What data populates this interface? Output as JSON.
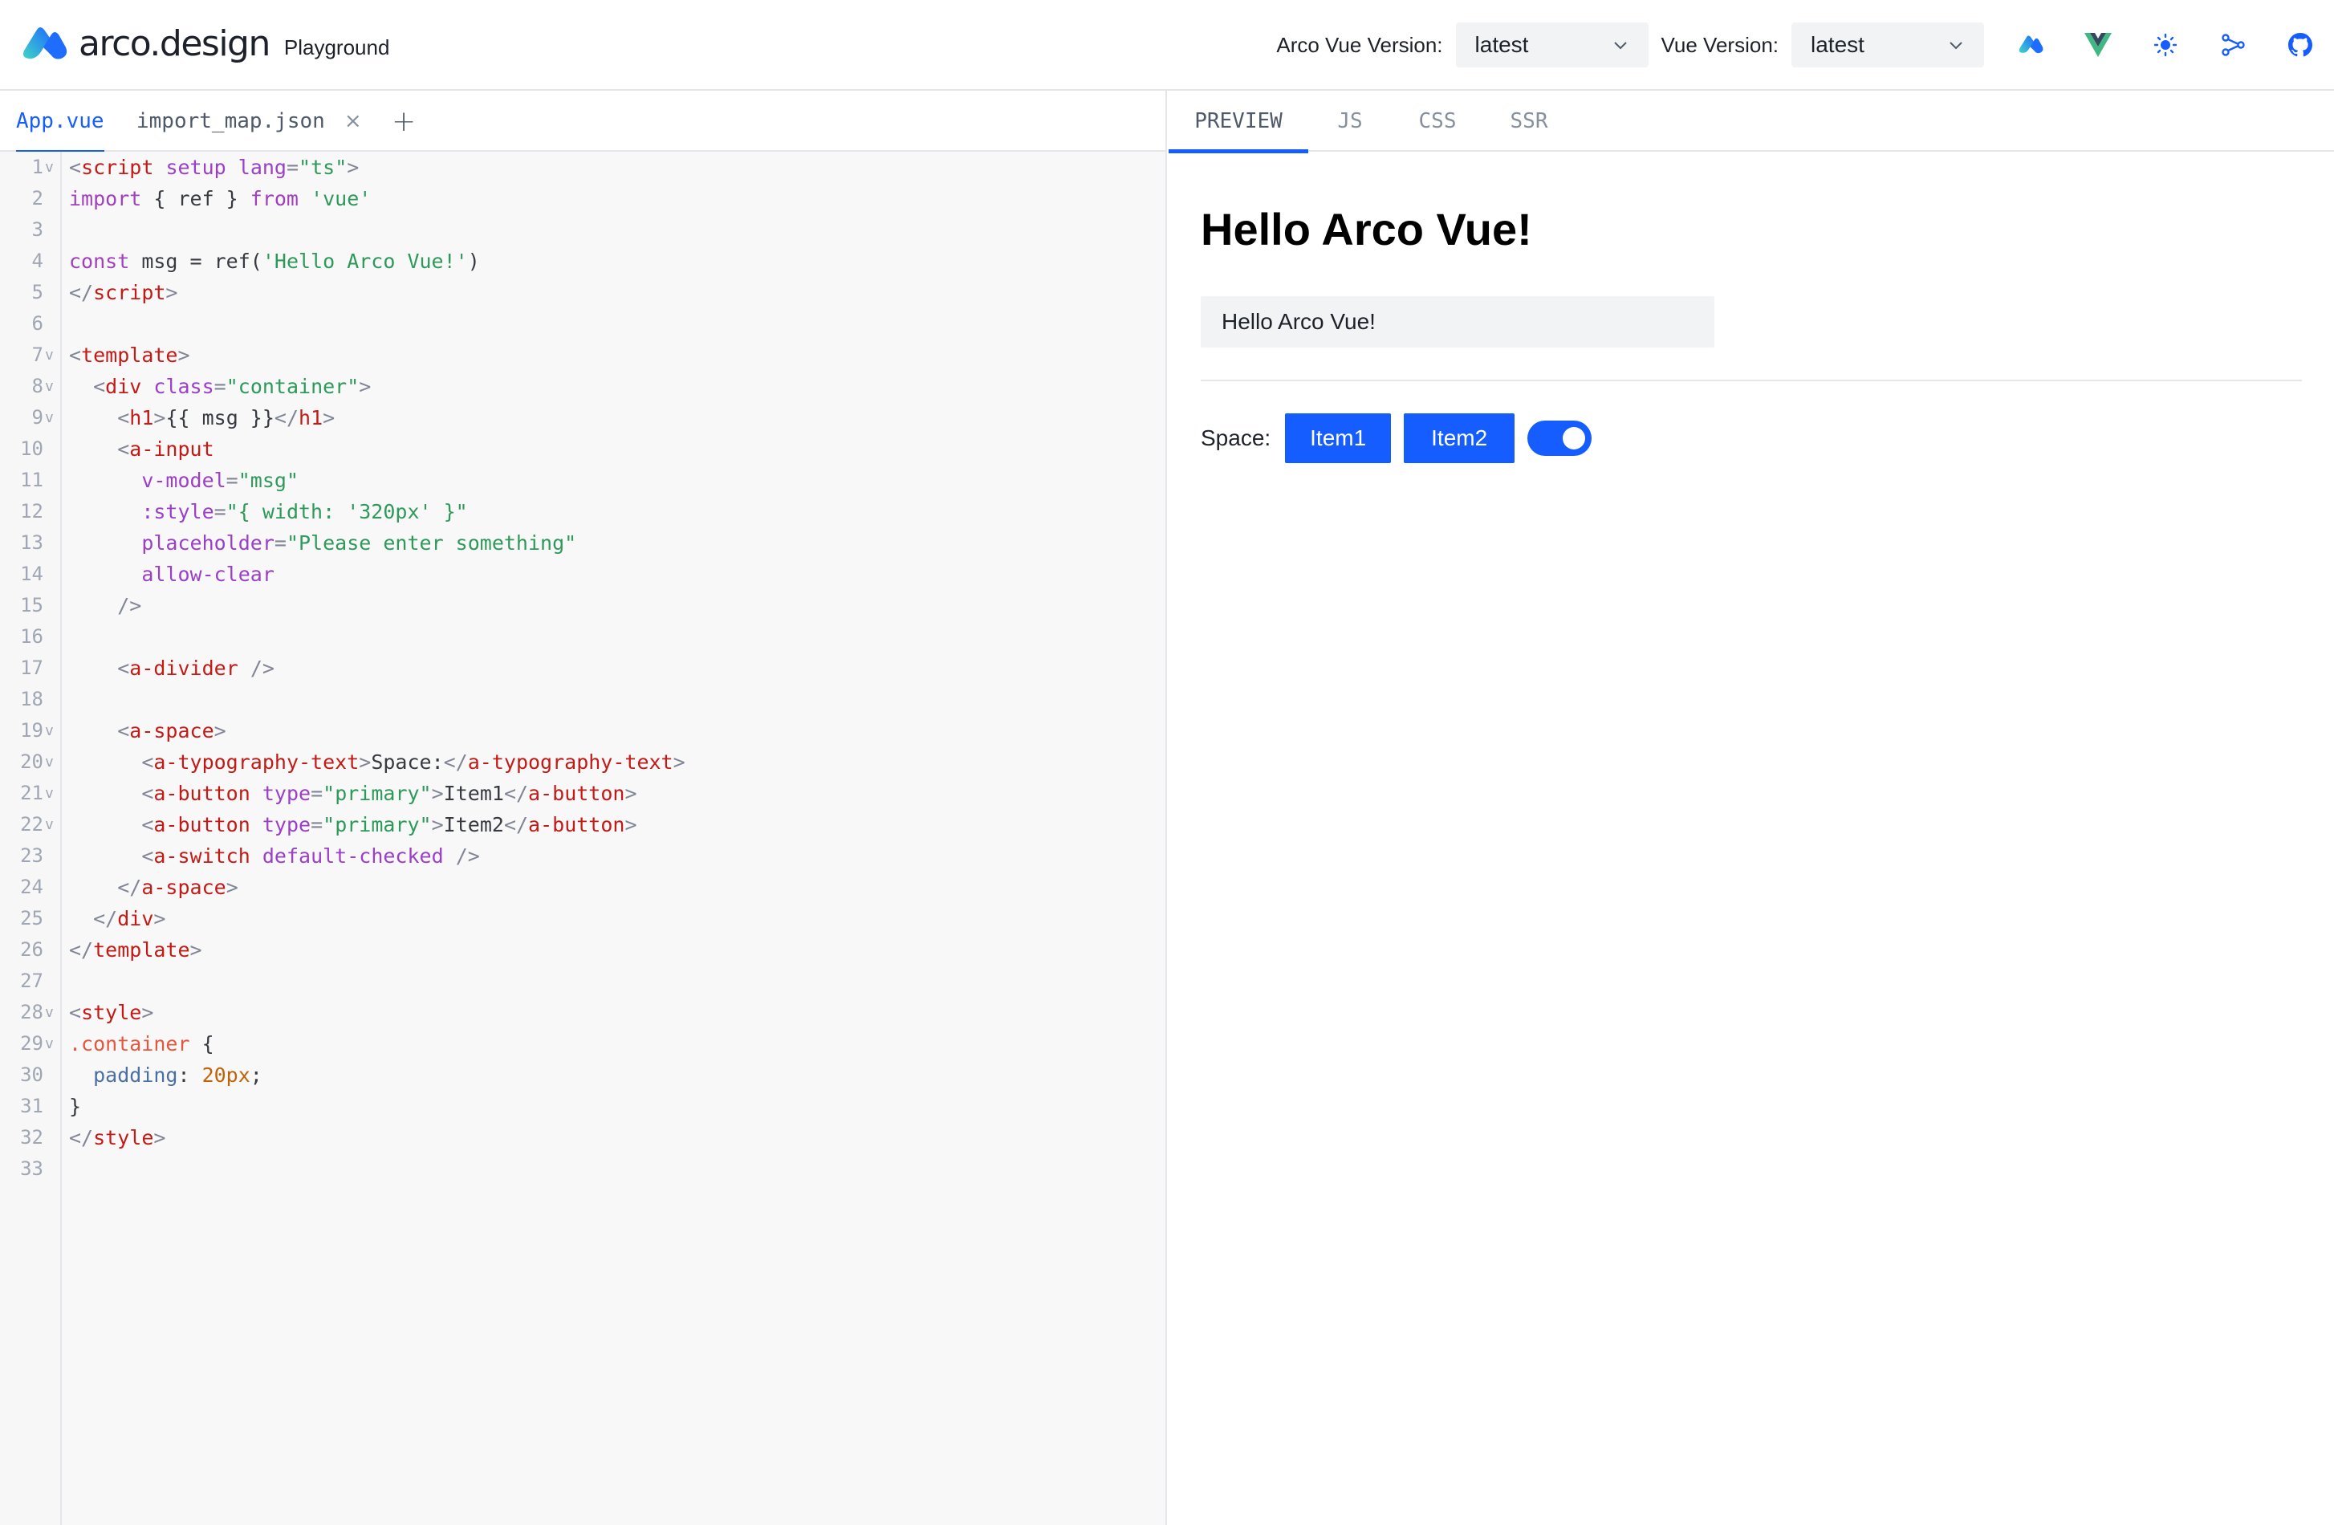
{
  "header": {
    "brand": "arco.design",
    "subtitle": "Playground",
    "arco_version_label": "Arco Vue Version:",
    "arco_version_value": "latest",
    "vue_version_label": "Vue Version:",
    "vue_version_value": "latest",
    "icons": [
      "arco-logo-icon",
      "vue-logo-icon",
      "theme-sun-icon",
      "share-icon",
      "github-icon"
    ]
  },
  "file_tabs": {
    "items": [
      {
        "label": "App.vue",
        "active": true,
        "closable": false
      },
      {
        "label": "import_map.json",
        "active": false,
        "closable": true
      }
    ],
    "close_glyph": "×",
    "add_glyph": "+"
  },
  "editor": {
    "lines": [
      {
        "n": "1",
        "fold": "v",
        "tokens": [
          [
            "punc",
            "<"
          ],
          [
            "tag",
            "script"
          ],
          [
            "plain",
            " "
          ],
          [
            "attr",
            "setup"
          ],
          [
            "plain",
            " "
          ],
          [
            "attr",
            "lang"
          ],
          [
            "punc",
            "="
          ],
          [
            "str",
            "\"ts\""
          ],
          [
            "punc",
            ">"
          ]
        ]
      },
      {
        "n": "2",
        "fold": "",
        "tokens": [
          [
            "kw",
            "import"
          ],
          [
            "plain",
            " { ref } "
          ],
          [
            "kw",
            "from"
          ],
          [
            "plain",
            " "
          ],
          [
            "str",
            "'vue'"
          ]
        ]
      },
      {
        "n": "3",
        "fold": "",
        "tokens": []
      },
      {
        "n": "4",
        "fold": "",
        "tokens": [
          [
            "kw",
            "const"
          ],
          [
            "plain",
            " msg = ref("
          ],
          [
            "str",
            "'Hello Arco Vue!'"
          ],
          [
            "plain",
            ")"
          ]
        ]
      },
      {
        "n": "5",
        "fold": "",
        "tokens": [
          [
            "punc",
            "</"
          ],
          [
            "tag",
            "script"
          ],
          [
            "punc",
            ">"
          ]
        ]
      },
      {
        "n": "6",
        "fold": "",
        "tokens": []
      },
      {
        "n": "7",
        "fold": "v",
        "tokens": [
          [
            "punc",
            "<"
          ],
          [
            "tag",
            "template"
          ],
          [
            "punc",
            ">"
          ]
        ]
      },
      {
        "n": "8",
        "fold": "v",
        "tokens": [
          [
            "plain",
            "  "
          ],
          [
            "punc",
            "<"
          ],
          [
            "tag",
            "div"
          ],
          [
            "plain",
            " "
          ],
          [
            "attr",
            "class"
          ],
          [
            "punc",
            "="
          ],
          [
            "str",
            "\"container\""
          ],
          [
            "punc",
            ">"
          ]
        ]
      },
      {
        "n": "9",
        "fold": "v",
        "tokens": [
          [
            "plain",
            "    "
          ],
          [
            "punc",
            "<"
          ],
          [
            "tag",
            "h1"
          ],
          [
            "punc",
            ">"
          ],
          [
            "plain",
            "{{ msg }}"
          ],
          [
            "punc",
            "</"
          ],
          [
            "tag",
            "h1"
          ],
          [
            "punc",
            ">"
          ]
        ]
      },
      {
        "n": "10",
        "fold": "",
        "tokens": [
          [
            "plain",
            "    "
          ],
          [
            "punc",
            "<"
          ],
          [
            "tag",
            "a-input"
          ]
        ]
      },
      {
        "n": "11",
        "fold": "",
        "tokens": [
          [
            "plain",
            "      "
          ],
          [
            "attr",
            "v-model"
          ],
          [
            "punc",
            "="
          ],
          [
            "str",
            "\"msg\""
          ]
        ]
      },
      {
        "n": "12",
        "fold": "",
        "tokens": [
          [
            "plain",
            "      "
          ],
          [
            "attr",
            ":style"
          ],
          [
            "punc",
            "="
          ],
          [
            "str",
            "\"{ width: '320px' }\""
          ]
        ]
      },
      {
        "n": "13",
        "fold": "",
        "tokens": [
          [
            "plain",
            "      "
          ],
          [
            "attr",
            "placeholder"
          ],
          [
            "punc",
            "="
          ],
          [
            "str",
            "\"Please enter something\""
          ]
        ]
      },
      {
        "n": "14",
        "fold": "",
        "tokens": [
          [
            "plain",
            "      "
          ],
          [
            "attr",
            "allow-clear"
          ]
        ]
      },
      {
        "n": "15",
        "fold": "",
        "tokens": [
          [
            "plain",
            "    "
          ],
          [
            "punc",
            "/>"
          ]
        ]
      },
      {
        "n": "16",
        "fold": "",
        "tokens": []
      },
      {
        "n": "17",
        "fold": "",
        "tokens": [
          [
            "plain",
            "    "
          ],
          [
            "punc",
            "<"
          ],
          [
            "tag",
            "a-divider"
          ],
          [
            "plain",
            " "
          ],
          [
            "punc",
            "/>"
          ]
        ]
      },
      {
        "n": "18",
        "fold": "",
        "tokens": []
      },
      {
        "n": "19",
        "fold": "v",
        "tokens": [
          [
            "plain",
            "    "
          ],
          [
            "punc",
            "<"
          ],
          [
            "tag",
            "a-space"
          ],
          [
            "punc",
            ">"
          ]
        ]
      },
      {
        "n": "20",
        "fold": "v",
        "tokens": [
          [
            "plain",
            "      "
          ],
          [
            "punc",
            "<"
          ],
          [
            "tag",
            "a-typography-text"
          ],
          [
            "punc",
            ">"
          ],
          [
            "plain",
            "Space:"
          ],
          [
            "punc",
            "</"
          ],
          [
            "tag",
            "a-typography-text"
          ],
          [
            "punc",
            ">"
          ]
        ]
      },
      {
        "n": "21",
        "fold": "v",
        "tokens": [
          [
            "plain",
            "      "
          ],
          [
            "punc",
            "<"
          ],
          [
            "tag",
            "a-button"
          ],
          [
            "plain",
            " "
          ],
          [
            "attr",
            "type"
          ],
          [
            "punc",
            "="
          ],
          [
            "str",
            "\"primary\""
          ],
          [
            "punc",
            ">"
          ],
          [
            "plain",
            "Item1"
          ],
          [
            "punc",
            "</"
          ],
          [
            "tag",
            "a-button"
          ],
          [
            "punc",
            ">"
          ]
        ]
      },
      {
        "n": "22",
        "fold": "v",
        "tokens": [
          [
            "plain",
            "      "
          ],
          [
            "punc",
            "<"
          ],
          [
            "tag",
            "a-button"
          ],
          [
            "plain",
            " "
          ],
          [
            "attr",
            "type"
          ],
          [
            "punc",
            "="
          ],
          [
            "str",
            "\"primary\""
          ],
          [
            "punc",
            ">"
          ],
          [
            "plain",
            "Item2"
          ],
          [
            "punc",
            "</"
          ],
          [
            "tag",
            "a-button"
          ],
          [
            "punc",
            ">"
          ]
        ]
      },
      {
        "n": "23",
        "fold": "",
        "tokens": [
          [
            "plain",
            "      "
          ],
          [
            "punc",
            "<"
          ],
          [
            "tag",
            "a-switch"
          ],
          [
            "plain",
            " "
          ],
          [
            "attr",
            "default-checked"
          ],
          [
            "plain",
            " "
          ],
          [
            "punc",
            "/>"
          ]
        ]
      },
      {
        "n": "24",
        "fold": "",
        "tokens": [
          [
            "plain",
            "    "
          ],
          [
            "punc",
            "</"
          ],
          [
            "tag",
            "a-space"
          ],
          [
            "punc",
            ">"
          ]
        ]
      },
      {
        "n": "25",
        "fold": "",
        "tokens": [
          [
            "plain",
            "  "
          ],
          [
            "punc",
            "</"
          ],
          [
            "tag",
            "div"
          ],
          [
            "punc",
            ">"
          ]
        ]
      },
      {
        "n": "26",
        "fold": "",
        "tokens": [
          [
            "punc",
            "</"
          ],
          [
            "tag",
            "template"
          ],
          [
            "punc",
            ">"
          ]
        ]
      },
      {
        "n": "27",
        "fold": "",
        "tokens": []
      },
      {
        "n": "28",
        "fold": "v",
        "tokens": [
          [
            "punc",
            "<"
          ],
          [
            "tag",
            "style"
          ],
          [
            "punc",
            ">"
          ]
        ]
      },
      {
        "n": "29",
        "fold": "v",
        "tokens": [
          [
            "sel",
            ".container"
          ],
          [
            "plain",
            " {"
          ]
        ]
      },
      {
        "n": "30",
        "fold": "",
        "tokens": [
          [
            "plain",
            "  "
          ],
          [
            "prop",
            "padding"
          ],
          [
            "plain",
            ": "
          ],
          [
            "num",
            "20px"
          ],
          [
            "plain",
            ";"
          ]
        ]
      },
      {
        "n": "31",
        "fold": "",
        "tokens": [
          [
            "plain",
            "}"
          ]
        ]
      },
      {
        "n": "32",
        "fold": "",
        "tokens": [
          [
            "punc",
            "</"
          ],
          [
            "tag",
            "style"
          ],
          [
            "punc",
            ">"
          ]
        ]
      },
      {
        "n": "33",
        "fold": "",
        "tokens": []
      }
    ]
  },
  "output_tabs": {
    "items": [
      "PREVIEW",
      "JS",
      "CSS",
      "SSR"
    ],
    "active": "PREVIEW"
  },
  "preview": {
    "title": "Hello Arco Vue!",
    "input_value": "Hello Arco Vue!",
    "space_label": "Space:",
    "button1": "Item1",
    "button2": "Item2",
    "switch_checked": true
  },
  "colors": {
    "primary": "#165dff",
    "border": "#e5e6eb",
    "editor_bg": "#f8f8f8"
  }
}
